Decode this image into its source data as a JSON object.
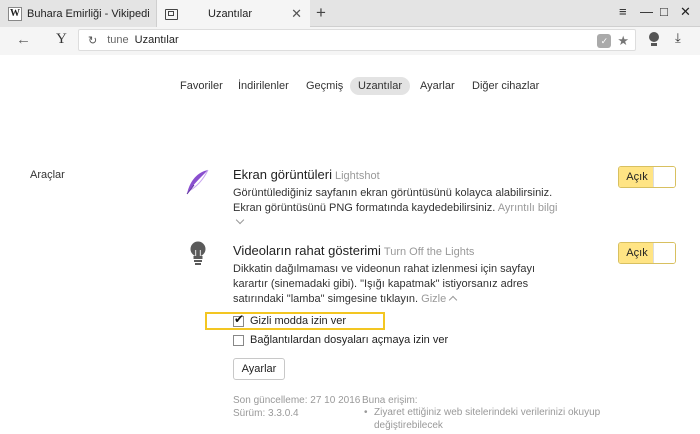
{
  "tabs": [
    {
      "title": "Buhara Emirliği - Vikipedi",
      "icon": "wikipedia-icon"
    },
    {
      "title": "Uzantılar",
      "icon": "extensions-page-icon"
    }
  ],
  "window": {
    "menu": "≡",
    "minimize": "—",
    "maximize": "□",
    "close": "✕"
  },
  "address": {
    "scheme": "tune",
    "title": "Uzantılar"
  },
  "nav": {
    "items": [
      "Favoriler",
      "İndirilenler",
      "Geçmiş",
      "Uzantılar",
      "Ayarlar",
      "Diğer cihazlar"
    ],
    "active": "Uzantılar"
  },
  "section": {
    "label": "Araçlar"
  },
  "extensions": [
    {
      "name": "Ekran görüntüleri",
      "source": "Lightshot",
      "description": "Görüntülediğiniz sayfanın ekran görüntüsünü kolayca alabilirsiniz. Ekran görüntüsünü PNG formatında kaydedebilirsiniz.",
      "more_label": "Ayrıntılı bilgi",
      "toggle_label": "Açık",
      "icon": "feather-icon"
    },
    {
      "name": "Videoların rahat gösterimi",
      "source": "Turn Off the Lights",
      "description": "Dikkatin dağılmaması ve videonun rahat izlenmesi için sayfayı karartır (sinemadaki gibi). \"Işığı kapatmak\" istiyorsanız adres satırındaki \"lamba\" simgesine tıklayın.",
      "hide_label": "Gizle",
      "toggle_label": "Açık",
      "icon": "lightbulb-icon",
      "options": [
        {
          "label": "Gizli modda izin ver",
          "checked": true
        },
        {
          "label": "Bağlantılardan dosyaları açmaya izin ver",
          "checked": false
        }
      ],
      "settings_button": "Ayarlar",
      "last_update": "Son güncelleme: 27 10 2016",
      "version": "Sürüm: 3.3.0.4",
      "access_title": "Buna erişim:",
      "access_items": [
        "Ziyaret ettiğiniz web sitelerindeki verilerinizi okuyup değiştirebilecek"
      ]
    }
  ],
  "colors": {
    "accent": "#ffe484",
    "highlight": "#f3c622",
    "feather": "#8a4fcf"
  }
}
